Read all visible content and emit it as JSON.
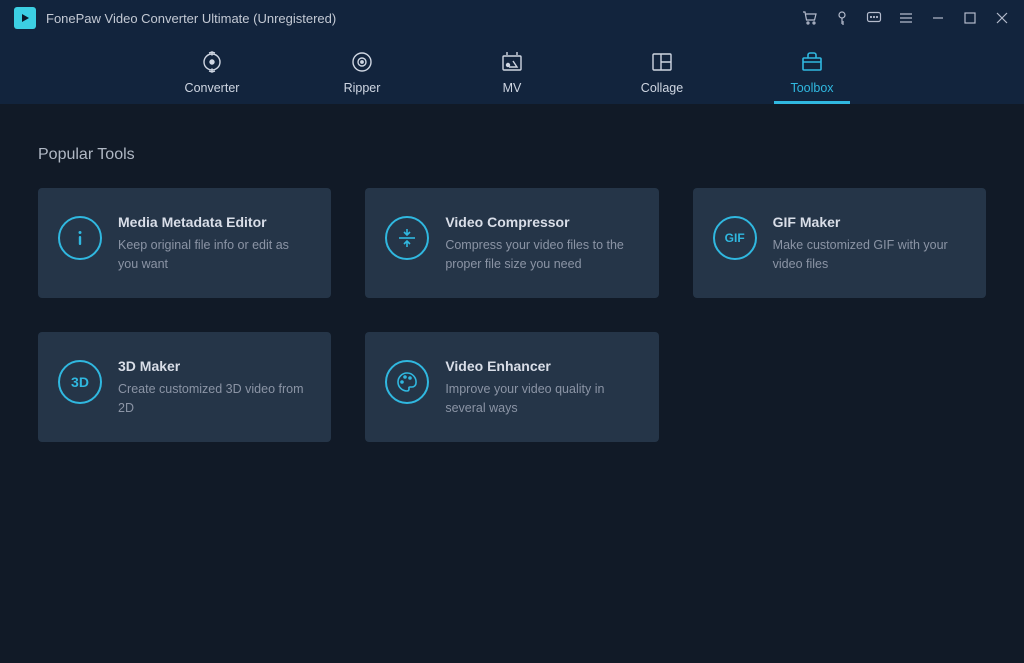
{
  "app": {
    "title": "FonePaw Video Converter Ultimate (Unregistered)"
  },
  "tabs": [
    {
      "label": "Converter"
    },
    {
      "label": "Ripper"
    },
    {
      "label": "MV"
    },
    {
      "label": "Collage"
    },
    {
      "label": "Toolbox"
    }
  ],
  "section": {
    "title": "Popular Tools"
  },
  "tools": [
    {
      "icon": "i",
      "title": "Media Metadata Editor",
      "desc": "Keep original file info or edit as you want"
    },
    {
      "icon": "compress",
      "title": "Video Compressor",
      "desc": "Compress your video files to the proper file size you need"
    },
    {
      "icon": "GIF",
      "title": "GIF Maker",
      "desc": "Make customized GIF with your video files"
    },
    {
      "icon": "3D",
      "title": "3D Maker",
      "desc": "Create customized 3D video from 2D"
    },
    {
      "icon": "palette",
      "title": "Video Enhancer",
      "desc": "Improve your video quality in several ways"
    }
  ]
}
